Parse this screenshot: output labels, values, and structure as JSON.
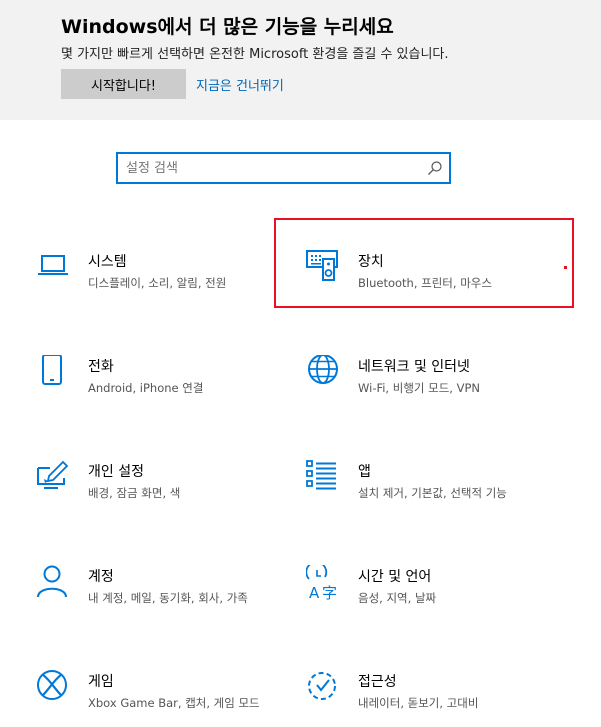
{
  "banner": {
    "title": "Windows에서 더 많은 기능을 누리세요",
    "subtitle": "몇 가지만 빠르게 선택하면 온전한 Microsoft 환경을 즐길 수 있습니다.",
    "start_label": "시작합니다!",
    "skip_label": "지금은 건너뛰기"
  },
  "search": {
    "placeholder": "설정 검색",
    "icon": "search-icon"
  },
  "tiles": [
    {
      "title": "시스템",
      "desc": "디스플레이, 소리, 알림, 전원",
      "icon": "laptop-icon"
    },
    {
      "title": "장치",
      "desc": "Bluetooth, 프린터, 마우스",
      "icon": "devices-icon"
    },
    {
      "title": "전화",
      "desc": "Android, iPhone 연결",
      "icon": "phone-icon"
    },
    {
      "title": "네트워크 및 인터넷",
      "desc": "Wi-Fi, 비행기 모드, VPN",
      "icon": "globe-icon"
    },
    {
      "title": "개인 설정",
      "desc": "배경, 잠금 화면, 색",
      "icon": "personalization-icon"
    },
    {
      "title": "앱",
      "desc": "설치 제거, 기본값, 선택적 기능",
      "icon": "apps-icon"
    },
    {
      "title": "계정",
      "desc": "내 계정, 메일, 동기화, 회사, 가족",
      "icon": "person-icon"
    },
    {
      "title": "시간 및 언어",
      "desc": "음성, 지역, 날짜",
      "icon": "time-language-icon"
    },
    {
      "title": "게임",
      "desc": "Xbox Game Bar, 캡처, 게임 모드",
      "icon": "xbox-icon"
    },
    {
      "title": "접근성",
      "desc": "내레이터, 돋보기, 고대비",
      "icon": "accessibility-icon"
    }
  ],
  "colors": {
    "accent": "#0078d7",
    "highlight": "#e81123",
    "banner_bg": "#f2f2f2"
  }
}
